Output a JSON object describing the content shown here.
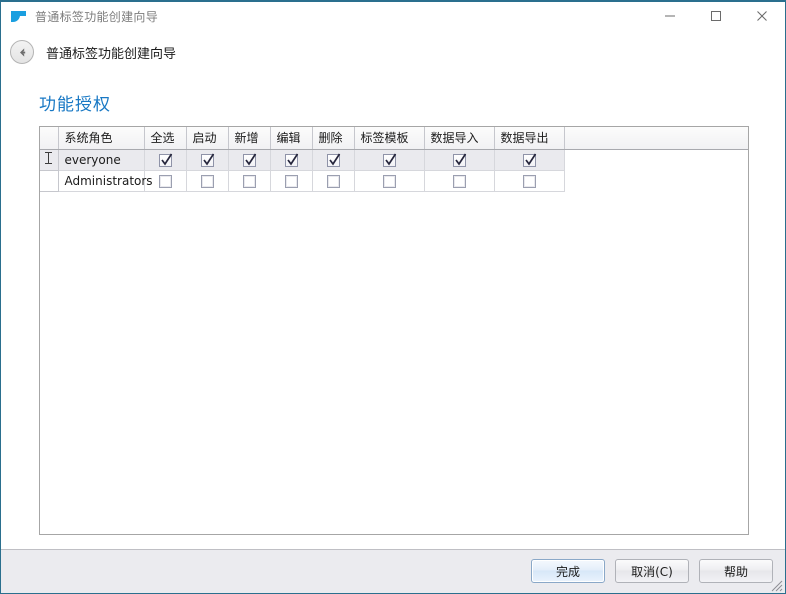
{
  "window": {
    "title": "普通标签功能创建向导",
    "app_icon": "flag-icon",
    "accent_color": "#2a6f8e",
    "controls": {
      "minimize": "minimize-icon",
      "maximize": "maximize-icon",
      "close": "close-icon"
    }
  },
  "nav": {
    "back_icon": "back-arrow-icon",
    "title": "普通标签功能创建向导"
  },
  "page": {
    "title": "功能授权",
    "title_color": "#1878c4"
  },
  "grid": {
    "columns": [
      "系统角色",
      "全选",
      "启动",
      "新增",
      "编辑",
      "删除",
      "标签模板",
      "数据导入",
      "数据导出"
    ],
    "rows": [
      {
        "role": "everyone",
        "selected": true,
        "cursor": "ibeam-cursor",
        "checks": [
          true,
          true,
          true,
          true,
          true,
          true,
          true,
          true
        ]
      },
      {
        "role": "Administrators",
        "selected": false,
        "cursor": "",
        "checks": [
          false,
          false,
          false,
          false,
          false,
          false,
          false,
          false
        ]
      }
    ]
  },
  "footer": {
    "buttons": [
      {
        "label": "完成",
        "default": true
      },
      {
        "label": "取消(C)",
        "default": false
      },
      {
        "label": "帮助",
        "default": false
      }
    ],
    "resize_grip": "resize-grip-icon"
  }
}
